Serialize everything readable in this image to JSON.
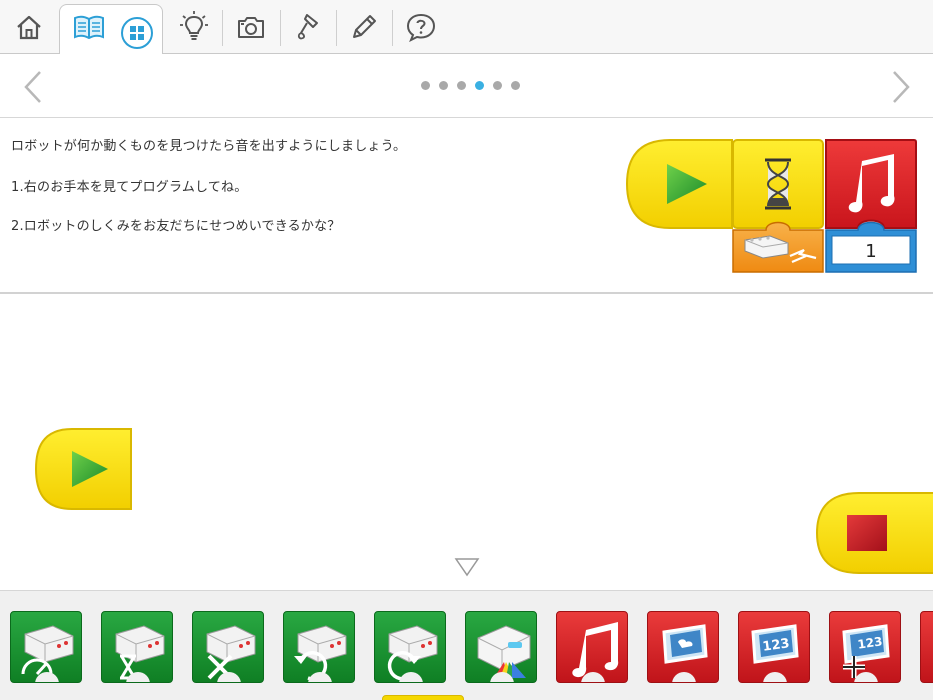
{
  "toolbar": {
    "items": [
      {
        "icon": "home-icon"
      },
      {
        "icon": "book-icon",
        "active": true
      },
      {
        "icon": "grid-icon"
      },
      {
        "icon": "lightbulb-icon"
      },
      {
        "icon": "camera-icon"
      },
      {
        "icon": "microphone-icon"
      },
      {
        "icon": "pencil-icon"
      },
      {
        "icon": "help-icon"
      }
    ]
  },
  "pagination": {
    "total": 6,
    "current": 4,
    "prev_icon": "chevron-left-icon",
    "next_icon": "chevron-right-icon"
  },
  "instructions": {
    "line1": "ロボットが何か動くものを見つけたら音を出すようにしましょう。",
    "line2": "1.右のお手本を見てプログラムしてね。",
    "line3": "2.ロボットのしくみをお友だちにせつめいできるかな？"
  },
  "example_program": {
    "blocks": [
      "start-block",
      "wait-block",
      "sound-block"
    ],
    "wait_input": "motion-sensor",
    "sound_value": "1"
  },
  "canvas": {
    "start_block": "start-block",
    "stop_block": "stop-block",
    "collapse_icon": "triangle-down-icon"
  },
  "palette": {
    "blocks": [
      {
        "name": "motor-speed-block",
        "color": "green"
      },
      {
        "name": "motor-wait-block",
        "color": "green"
      },
      {
        "name": "motor-off-block",
        "color": "green"
      },
      {
        "name": "motor-direction-left-block",
        "color": "green"
      },
      {
        "name": "motor-direction-right-block",
        "color": "green"
      },
      {
        "name": "light-color-block",
        "color": "green"
      },
      {
        "name": "sound-block",
        "color": "red"
      },
      {
        "name": "display-image-block",
        "color": "red"
      },
      {
        "name": "display-text-block",
        "color": "red"
      },
      {
        "name": "display-add-block",
        "color": "red"
      }
    ],
    "display_number_label": "123"
  },
  "colors": {
    "accent": "#3ab0e2",
    "yellow_block": "#f5d800",
    "green_block": "#1f9a36",
    "red_block": "#d9212a",
    "orange_block": "#f39a1e",
    "blue_input": "#2f8fd6"
  }
}
